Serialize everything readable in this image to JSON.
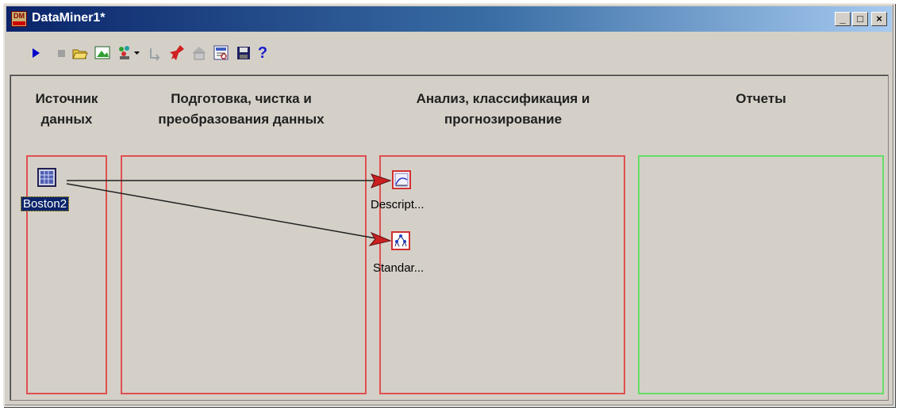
{
  "window": {
    "title": "DataMiner1*",
    "app_icon_text": "DM"
  },
  "title_buttons": {
    "minimize": "_",
    "maximize": "□",
    "close": "×"
  },
  "toolbar": {
    "help_label": "?"
  },
  "columns": [
    {
      "line1": "Источник",
      "line2": "данных"
    },
    {
      "line1": "Подготовка, чистка и",
      "line2": "преобразования данных"
    },
    {
      "line1": "Анализ, классификация и",
      "line2": "прогнозирование"
    },
    {
      "line1": "Отчеты",
      "line2": ""
    }
  ],
  "nodes": {
    "source": {
      "label": "Boston2",
      "icon": "table-icon"
    },
    "descriptive": {
      "label": "Descript...",
      "icon": "chart-icon"
    },
    "standard": {
      "label": "Standar...",
      "icon": "tree-icon"
    }
  },
  "colors": {
    "analysis_zone": "#e05050",
    "reports_zone": "#66dd66",
    "arrow": "#cc2020",
    "selection": "#0a246a"
  }
}
